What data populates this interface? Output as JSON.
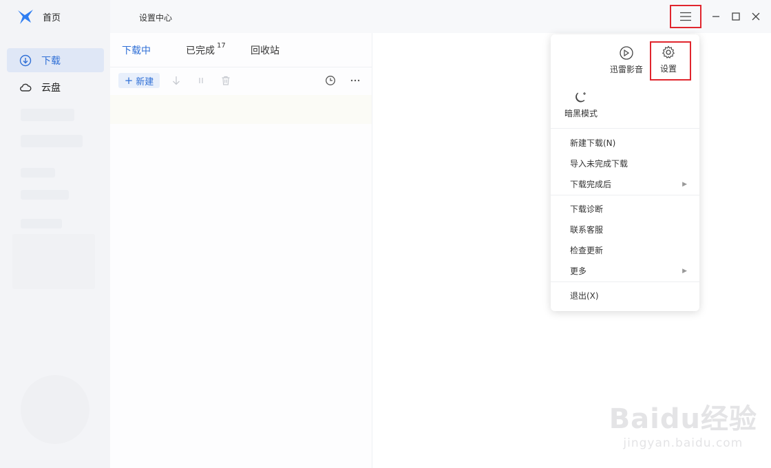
{
  "sidebar": {
    "home_label": "首页",
    "items": [
      {
        "label": "下载",
        "icon": "download-circle-icon",
        "active": true
      },
      {
        "label": "云盘",
        "icon": "cloud-icon",
        "active": false
      }
    ]
  },
  "titlebar": {
    "title": "设置中心"
  },
  "tabs": [
    {
      "label": "下载中",
      "active": true
    },
    {
      "label": "已完成",
      "badge": "17",
      "active": false
    },
    {
      "label": "回收站",
      "active": false
    }
  ],
  "toolbar": {
    "new_label": "新建"
  },
  "menu": {
    "grid": [
      {
        "label": "迅雷影音",
        "icon": "player-icon"
      },
      {
        "label": "设置",
        "icon": "gear-icon"
      },
      {
        "label": "暗黑模式",
        "icon": "moon-icon"
      }
    ],
    "group1": [
      {
        "label": "新建下载(N)",
        "has_submenu": false
      },
      {
        "label": "导入未完成下载",
        "has_submenu": false
      },
      {
        "label": "下载完成后",
        "has_submenu": true
      }
    ],
    "group2": [
      {
        "label": "下载诊断",
        "has_submenu": false
      },
      {
        "label": "联系客服",
        "has_submenu": false
      },
      {
        "label": "检查更新",
        "has_submenu": false
      },
      {
        "label": "更多",
        "has_submenu": true
      }
    ],
    "group3": [
      {
        "label": "退出(X)",
        "has_submenu": false
      }
    ]
  },
  "watermark": {
    "brand": "Baidu经验",
    "url": "jingyan.baidu.com"
  },
  "colors": {
    "accent": "#2f6fd6",
    "highlight_box": "#e0252d",
    "sidebar_bg": "#f3f4f7"
  }
}
